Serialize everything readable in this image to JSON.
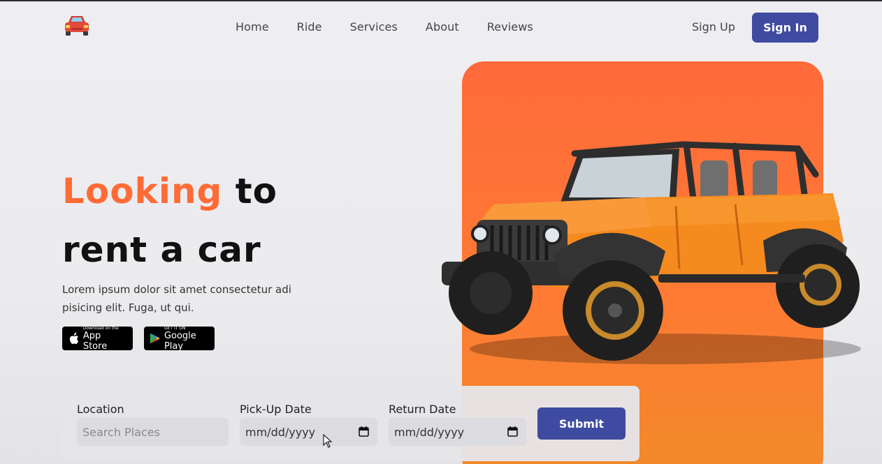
{
  "header": {
    "nav": [
      "Home",
      "Ride",
      "Services",
      "About",
      "Reviews"
    ],
    "signup_label": "Sign Up",
    "signin_label": "Sign In"
  },
  "hero": {
    "title_accent": "Looking",
    "title_rest_1": " to",
    "title_line_2": "rent a car",
    "description": "Lorem ipsum dolor sit amet consectetur adi pisicing elit. Fuga, ut qui.",
    "app_store": {
      "small": "Download on the",
      "big": "App Store"
    },
    "google_play": {
      "small": "GET IT ON",
      "big": "Google Play"
    }
  },
  "form": {
    "location_label": "Location",
    "location_placeholder": "Search Places",
    "pickup_label": "Pick-Up Date",
    "pickup_value": "mm/dd/yyyy",
    "return_label": "Return Date",
    "return_value": "mm/dd/yyyy",
    "submit_label": "Submit"
  },
  "colors": {
    "accent": "#ff6b36",
    "primary": "#3f4ba0",
    "card": "#ff6a3a"
  },
  "icons": [
    "car-logo-icon",
    "apple-icon",
    "google-play-icon",
    "calendar-icon",
    "mouse-cursor-icon"
  ]
}
